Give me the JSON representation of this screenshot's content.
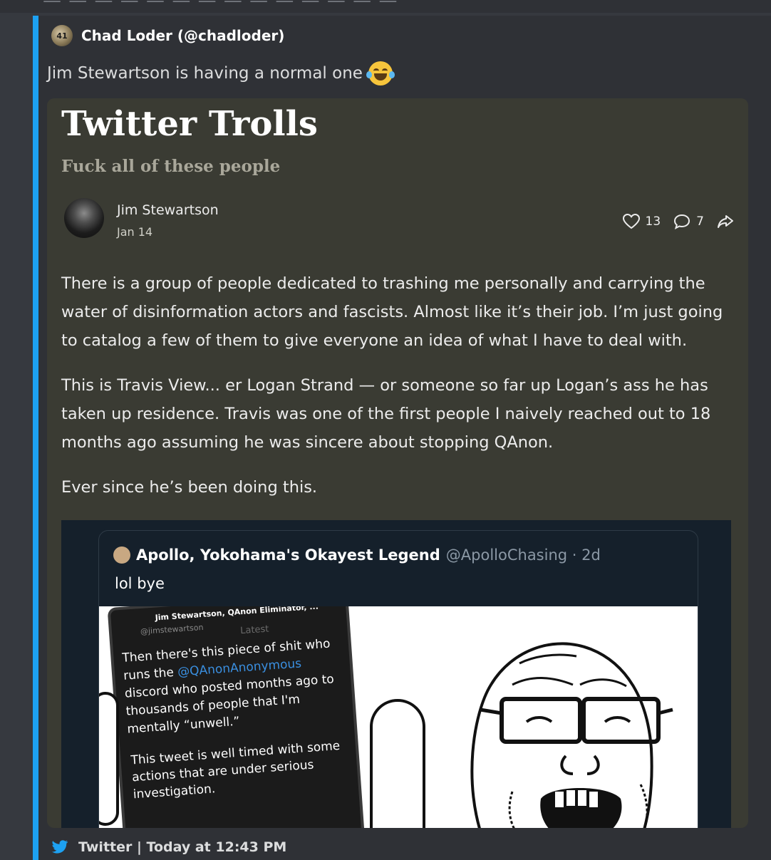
{
  "embed": {
    "accent_color": "#1da1f2",
    "author": "Chad Loder (@chadloder)",
    "description": "Jim Stewartson is having a normal one",
    "description_emoji": "joy-emoji"
  },
  "post": {
    "title": "Twitter Trolls",
    "subtitle": "Fuck all of these people",
    "author_name": "Jim Stewartson",
    "date": "Jan 14",
    "likes": "13",
    "comments": "7",
    "paragraphs": [
      "There is a group of people dedicated to trashing me personally and carrying the water of disinformation actors and fascists. Almost like it’s their job. I’m just going to catalog a few of them to give everyone an idea of what I have to deal with.",
      "This is Travis View... er Logan Strand — or someone so far up Logan’s ass he has taken up residence. Travis was one of the first people I naively reached out to 18 months ago assuming he was sincere about stopping QAnon.",
      "Ever since he’s been doing this."
    ]
  },
  "tweet": {
    "name": "Apollo, Yokohama's Okayest Legend",
    "handle": "@ApolloChasing · 2d",
    "text": "lol bye",
    "phone": {
      "header": "Jim Stewartson, QAnon Eliminator, ...",
      "subhandle": "@jimstewartson",
      "latest": "Latest",
      "line1a": "Then there's this piece of shit who runs the ",
      "mention": "@QAnonAnonymous",
      "line1b": " discord who posted months ago to thousands of people that I'm mentally “unwell.”",
      "line2": "This tweet is well timed with some actions that are under serious investigation."
    }
  },
  "footer": {
    "text": "Twitter | Today at 12:43 PM"
  }
}
